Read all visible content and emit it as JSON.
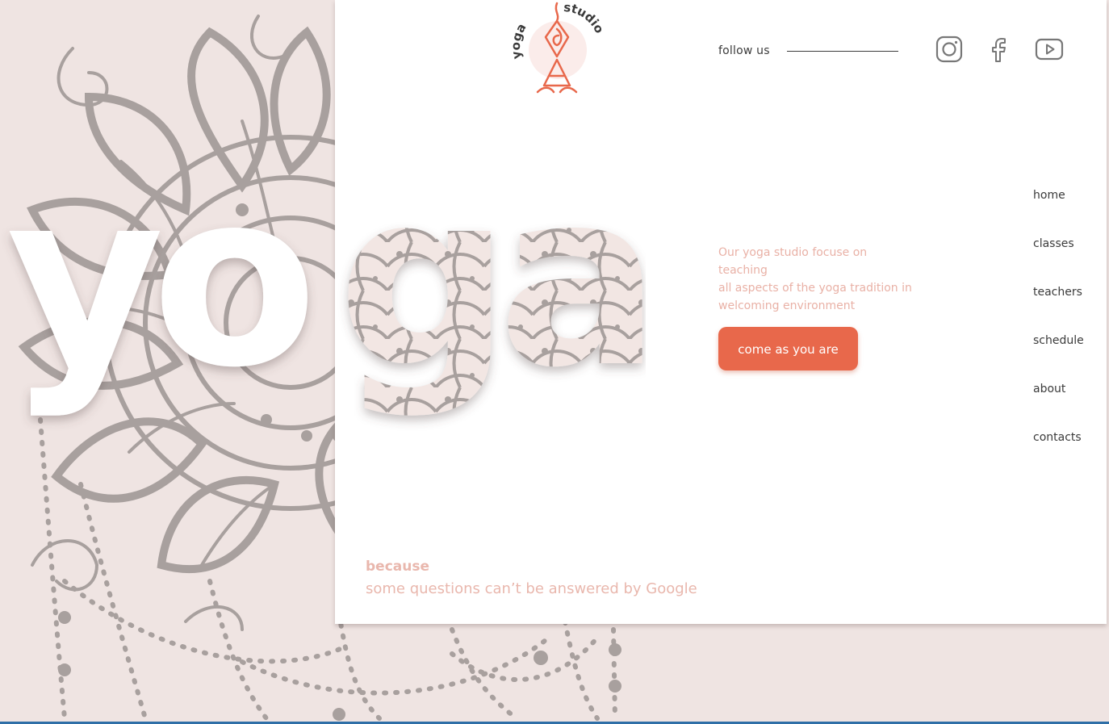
{
  "logo": {
    "left_text": "yoga",
    "right_text": "studio",
    "accent": "#e8684b"
  },
  "social": {
    "follow_label": "follow us",
    "icons": [
      "instagram-icon",
      "facebook-icon",
      "youtube-icon"
    ]
  },
  "hero": {
    "word": "yoga",
    "tagline": "Our yoga studio focuse on teaching\nall aspects of the yoga tradition in\nwelcoming environment",
    "cta_label": "come as you are"
  },
  "nav": {
    "items": [
      {
        "label": "home"
      },
      {
        "label": "classes"
      },
      {
        "label": "teachers"
      },
      {
        "label": "schedule"
      },
      {
        "label": "about"
      },
      {
        "label": "contacts"
      }
    ]
  },
  "footer": {
    "because": "because",
    "quote": "some questions can’t be answered by Google"
  },
  "colors": {
    "background": "#efe4e2",
    "panel": "#ffffff",
    "accent": "#e8684b",
    "soft_text": "#e9b7ad",
    "mandala": "#a8a09e"
  }
}
